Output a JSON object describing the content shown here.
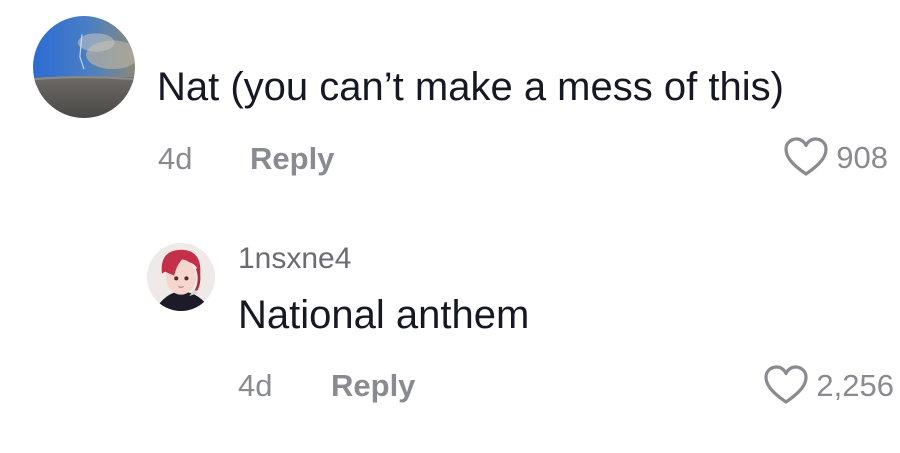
{
  "comments": [
    {
      "text": "Nat (you can’t make a mess of this)",
      "time": "4d",
      "reply_label": "Reply",
      "likes": "908",
      "avatar_icon": "avatar-sky-beach"
    }
  ],
  "reply": {
    "username": "1nsxne4",
    "text": "National anthem",
    "time": "4d",
    "reply_label": "Reply",
    "likes": "2,256",
    "avatar_icon": "avatar-anime-character"
  },
  "colors": {
    "primary_text": "#161823",
    "secondary_text": "#8a8b91",
    "username_text": "#6b6b73",
    "heart_stroke": "#8a8b91"
  }
}
